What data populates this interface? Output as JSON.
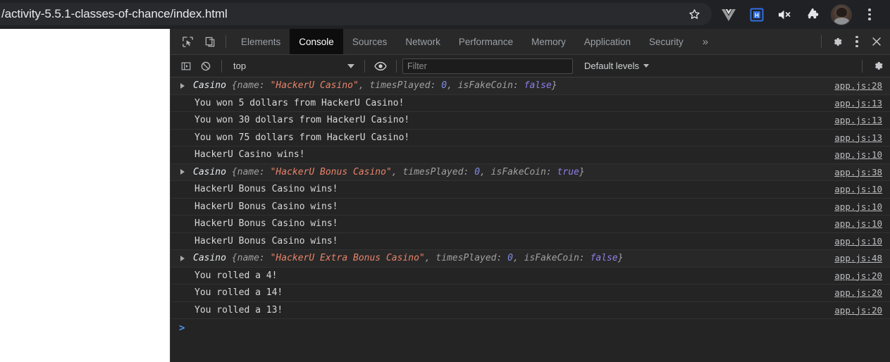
{
  "browser": {
    "url": "/activity-5.5.1-classes-of-chance/index.html",
    "actions": [
      {
        "name": "bookmark-star-icon",
        "glyph": "star"
      },
      {
        "name": "vue-devtools-icon",
        "glyph": "v"
      },
      {
        "name": "extension-blue-icon",
        "glyph": "blue-square"
      },
      {
        "name": "tab-muted-icon",
        "glyph": "speaker-mute"
      },
      {
        "name": "extensions-puzzle-icon",
        "glyph": "puzzle"
      },
      {
        "name": "profile-avatar",
        "glyph": "avatar"
      },
      {
        "name": "chrome-menu-icon",
        "glyph": "kebab"
      }
    ]
  },
  "devtools": {
    "inspect_icon": "inspect-element-icon",
    "device_icon": "toggle-device-toolbar-icon",
    "tabs": [
      {
        "label": "Elements",
        "active": false
      },
      {
        "label": "Console",
        "active": true
      },
      {
        "label": "Sources",
        "active": false
      },
      {
        "label": "Network",
        "active": false
      },
      {
        "label": "Performance",
        "active": false
      },
      {
        "label": "Memory",
        "active": false
      },
      {
        "label": "Application",
        "active": false
      },
      {
        "label": "Security",
        "active": false
      }
    ],
    "more_tabs_label": "»",
    "settings_icon": "gear-icon",
    "more_options_icon": "kebab-menu-icon",
    "close_icon": "close-icon",
    "console_toolbar": {
      "sidebar_icon": "console-sidebar-icon",
      "clear_icon": "clear-console-icon",
      "context": "top",
      "eye_icon": "live-expression-eye-icon",
      "filter_placeholder": "Filter",
      "filter_value": "",
      "levels": "Default levels",
      "settings_icon": "console-settings-gear-icon"
    },
    "prompt": ">",
    "messages": [
      {
        "type": "object",
        "class_name": "Casino",
        "props": [
          {
            "key": "name",
            "value": "\"HackerU Casino\"",
            "kind": "string"
          },
          {
            "key": "timesPlayed",
            "value": "0",
            "kind": "number"
          },
          {
            "key": "isFakeCoin",
            "value": "false",
            "kind": "boolean"
          }
        ],
        "source": "app.js:28"
      },
      {
        "type": "text",
        "text": "You won 5 dollars from HackerU Casino!",
        "source": "app.js:13"
      },
      {
        "type": "text",
        "text": "You won 30 dollars from HackerU Casino!",
        "source": "app.js:13"
      },
      {
        "type": "text",
        "text": "You won 75 dollars from HackerU Casino!",
        "source": "app.js:13"
      },
      {
        "type": "text",
        "text": "HackerU Casino wins!",
        "source": "app.js:10"
      },
      {
        "type": "object",
        "class_name": "Casino",
        "props": [
          {
            "key": "name",
            "value": "\"HackerU Bonus Casino\"",
            "kind": "string"
          },
          {
            "key": "timesPlayed",
            "value": "0",
            "kind": "number"
          },
          {
            "key": "isFakeCoin",
            "value": "true",
            "kind": "boolean"
          }
        ],
        "source": "app.js:38"
      },
      {
        "type": "text",
        "text": "HackerU Bonus Casino wins!",
        "source": "app.js:10"
      },
      {
        "type": "text",
        "text": "HackerU Bonus Casino wins!",
        "source": "app.js:10"
      },
      {
        "type": "text",
        "text": "HackerU Bonus Casino wins!",
        "source": "app.js:10"
      },
      {
        "type": "text",
        "text": "HackerU Bonus Casino wins!",
        "source": "app.js:10"
      },
      {
        "type": "object",
        "class_name": "Casino",
        "props": [
          {
            "key": "name",
            "value": "\"HackerU Extra Bonus Casino\"",
            "kind": "string"
          },
          {
            "key": "timesPlayed",
            "value": "0",
            "kind": "number"
          },
          {
            "key": "isFakeCoin",
            "value": "false",
            "kind": "boolean"
          }
        ],
        "source": "app.js:48"
      },
      {
        "type": "text",
        "text": "You rolled a 4!",
        "source": "app.js:20"
      },
      {
        "type": "text",
        "text": "You rolled a 14!",
        "source": "app.js:20"
      },
      {
        "type": "text",
        "text": "You rolled a 13!",
        "source": "app.js:20"
      }
    ]
  },
  "colors": {
    "chrome_bg": "#202124",
    "omnibox_bg": "#292a2d",
    "devtools_bg": "#242424",
    "tabbar_bg": "#292929",
    "active_tab_bg": "#0d0d0d",
    "string_token": "#e8836a",
    "number_token": "#7f8ce0",
    "boolean_token": "#8d7fe8",
    "link": "#bcbdc0",
    "prompt": "#4f94f8"
  }
}
